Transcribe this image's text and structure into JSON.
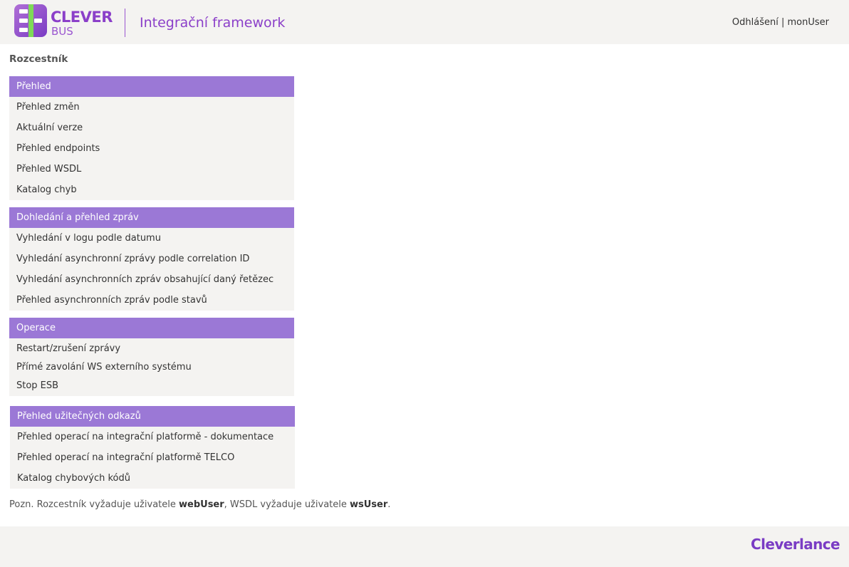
{
  "header": {
    "logo": {
      "line1": "CLEVER",
      "line2": "BUS"
    },
    "app_title": "Integrační framework",
    "logout_label": "Odhlášení",
    "separator": "|",
    "username": "monUser"
  },
  "page_title": "Rozcestník",
  "sections": [
    {
      "title": "Přehled",
      "items": [
        "Přehled změn",
        "Aktuální verze",
        "Přehled endpoints",
        "Přehled WSDL",
        "Katalog chyb"
      ]
    },
    {
      "title": "Dohledání a přehled zpráv",
      "items": [
        "Vyhledání v logu podle datumu",
        "Vyhledání asynchronní zprávy podle correlation ID",
        "Vyhledání asynchronních zpráv obsahující daný řetězec",
        "Přehled asynchronních zpráv podle stavů"
      ]
    },
    {
      "title": "Operace",
      "items": [
        "Restart/zrušení zprávy",
        "Přímé zavolání WS externího systému",
        "Stop ESB"
      ]
    },
    {
      "title": "Přehled užitečných odkazů",
      "items": [
        "Přehled operací na integrační platformě - dokumentace",
        "Přehled operací na integrační platformě TELCO",
        "Katalog chybových kódů"
      ]
    }
  ],
  "note": {
    "prefix": "Pozn. Rozcestník vyžaduje uživatele ",
    "user1": "webUser",
    "middle": ", WSDL vyžaduje uživatele ",
    "user2": "wsUser",
    "suffix": "."
  },
  "footer": {
    "brand": "Cleverlance"
  },
  "colors": {
    "brand_purple": "#8b3fc9",
    "section_header_bg": "#9b78d6",
    "panel_bg": "#f4f3f1",
    "logo_green": "#7ed957"
  },
  "icons": {
    "logo": "clever-bus-logo-icon"
  }
}
